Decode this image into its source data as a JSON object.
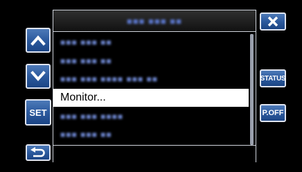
{
  "menu": {
    "title": "■■■ ■■■ ■■",
    "items": [
      {
        "label": "■■■ ■■■ ■■"
      },
      {
        "label": "■■■ ■■■ ■■"
      },
      {
        "label": "■■■ ■■■ ■■■■ ■■■ ■■"
      },
      {
        "label": "Monitor..."
      },
      {
        "label": "■■■ ■■■ ■■■■"
      },
      {
        "label": "■■■ ■■■ ■■"
      }
    ],
    "selected_index": 3,
    "scroll_fraction": 1.0
  },
  "buttons": {
    "set_label": "SET",
    "status_label": "STATUS",
    "power_off_label": "P.OFF"
  },
  "icons": {
    "up": "chevron-up-icon",
    "down": "chevron-down-icon",
    "back": "return-arrow-icon",
    "close": "close-x-icon"
  },
  "colors": {
    "button_blue": "#2c5a9e",
    "highlight": "#ffffff",
    "blurred_text": "#6d86cf"
  }
}
